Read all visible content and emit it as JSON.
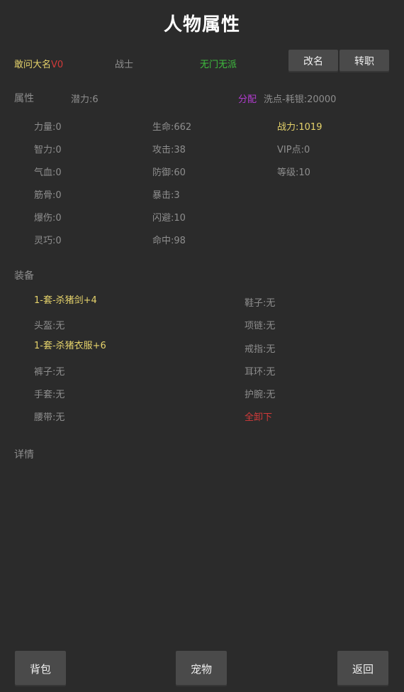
{
  "title": "人物属性",
  "header": {
    "name": "敢问大名",
    "vip": "V0",
    "role": "战士",
    "faction": "无门无派",
    "rename_btn": "改名",
    "transfer_btn": "转职"
  },
  "attributes": {
    "label": "属性",
    "potential": "潜力:6",
    "allocate": "分配",
    "wash_cost": "洗点-耗银:20000",
    "col1": [
      "力量:0",
      "智力:0",
      "气血:0",
      "筋骨:0",
      "爆伤:0",
      "灵巧:0"
    ],
    "col2": [
      "生命:662",
      "攻击:38",
      "防御:60",
      "暴击:3",
      "闪避:10",
      "命中:98"
    ],
    "col3": [
      "战力:1019",
      "VIP点:0",
      "等级:10"
    ]
  },
  "equipment": {
    "label": "装备",
    "weapon": "1-套-杀猪剑+4",
    "shoes": "鞋子:无",
    "helmet": "头盔:无",
    "necklace": "项链:无",
    "armor": "1-套-杀猪衣服+6",
    "ring": "戒指:无",
    "pants": "裤子:无",
    "earring": "耳环:无",
    "gloves": "手套:无",
    "amulet": "护腕:无",
    "belt": "腰带:无",
    "unequip": "全卸下"
  },
  "details": {
    "label": "详情"
  },
  "footer": {
    "bag": "背包",
    "pet": "宠物",
    "back": "返回"
  },
  "colors": {
    "background": "#2b2b2b",
    "button": "#4a4a4a",
    "yellow": "#e6d36b",
    "red": "#d23a3a",
    "green": "#3fbf3f",
    "purple": "#b23ccf"
  }
}
